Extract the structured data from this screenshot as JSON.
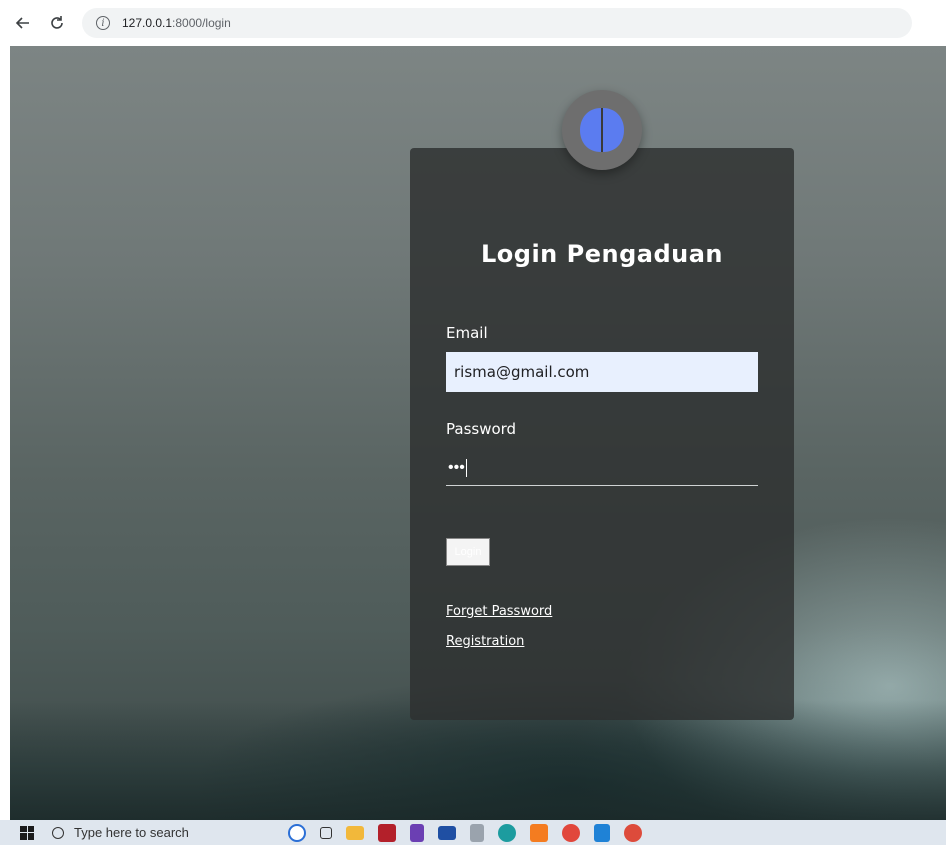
{
  "browser": {
    "url_host": "127.0.0.1",
    "url_path": ":8000/login"
  },
  "login": {
    "title": "Login Pengaduan",
    "email_label": "Email",
    "email_value": "risma@gmail.com",
    "password_label": "Password",
    "password_mask": "•••",
    "login_button": "Login",
    "forget_password_link": "Forget Password",
    "registration_link": "Registration"
  },
  "taskbar": {
    "search_placeholder": "Type here to search",
    "icons": [
      "bing-icon",
      "task-view-icon",
      "file-explorer-icon",
      "app-red-icon",
      "visual-studio-icon",
      "mail-icon",
      "app-grid-icon",
      "edge-icon",
      "xampp-icon",
      "chrome-icon",
      "vscode-icon",
      "chrome-profile-icon"
    ]
  },
  "colors": {
    "card_bg": "#2d3030",
    "email_bg": "#e8f0fe",
    "avatar_blue": "#5b7cf0",
    "avatar_ring": "#6e6e6e"
  }
}
